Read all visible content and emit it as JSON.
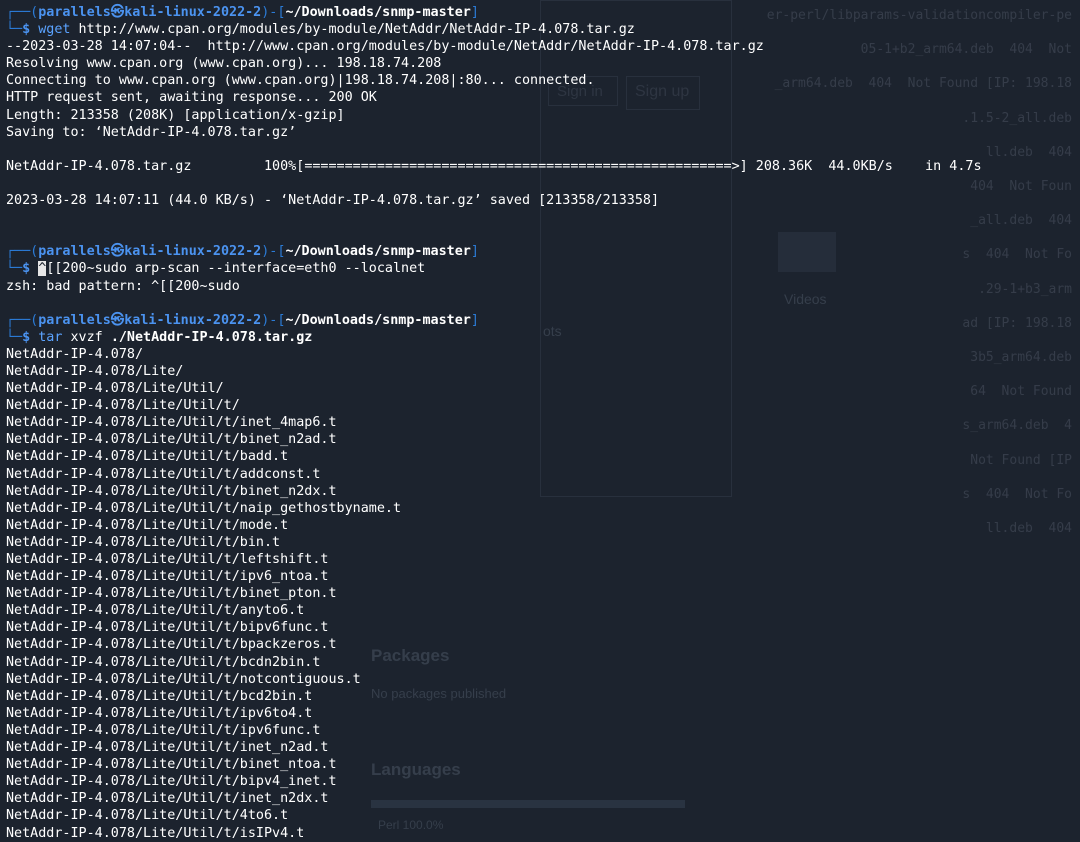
{
  "background_window": {
    "right_column": [
      "er-perl/libparams-validationcompiler-pe",
      "05-1+b2_arm64.deb  404  Not",
      "_arm64.deb  404  Not Found [IP: 198.18",
      ".1.5-2_all.deb",
      "ll.deb  404",
      "404  Not Foun",
      "_all.deb  404",
      "s  404  Not Fo",
      ".29-1+b3_arm",
      "ad [IP: 198.18",
      "3b5_arm64.deb",
      "64  Not Found",
      "s_arm64.deb  4",
      "Not Found [IP",
      "s  404  Not Fo",
      "ll.deb  404"
    ],
    "sign_in": "Sign in",
    "sign_up": "Sign up",
    "videos": "Videos",
    "packages_heading": "Packages",
    "packages_sub": "No packages published",
    "languages_heading": "Languages",
    "language_item": "Perl 100.0%",
    "ots": "ots"
  },
  "terminal": {
    "prompt": {
      "user_host": "parallels㉿kali-linux-2022-2",
      "path": "~/Downloads/snmp-master"
    },
    "block1": {
      "cmd": "wget",
      "args": " http://www.cpan.org/modules/by-module/NetAddr/NetAddr-IP-4.078.tar.gz",
      "output": [
        "--2023-03-28 14:07:04--  http://www.cpan.org/modules/by-module/NetAddr/NetAddr-IP-4.078.tar.gz",
        "Resolving www.cpan.org (www.cpan.org)... 198.18.74.208",
        "Connecting to www.cpan.org (www.cpan.org)|198.18.74.208|:80... connected.",
        "HTTP request sent, awaiting response... 200 OK",
        "Length: 213358 (208K) [application/x-gzip]",
        "Saving to: ‘NetAddr-IP-4.078.tar.gz’",
        ""
      ],
      "progress_file": "NetAddr-IP-4.078.tar.gz",
      "progress_pct": "100%",
      "progress_fraction": 1.0,
      "progress_stats": " 208.36K  44.0KB/s    in 4.7s",
      "saved_line": "2023-03-28 14:07:11 (44.0 KB/s) - ‘NetAddr-IP-4.078.tar.gz’ saved [213358/213358]"
    },
    "block2": {
      "cursor_char": "^",
      "cmd_rest": "[[200~sudo arp-scan --interface=eth0 --localnet",
      "output": "zsh: bad pattern: ^[[200~sudo"
    },
    "block3": {
      "cmd": "tar",
      "args": " xvzf ",
      "arg_bold": "./NetAddr-IP-4.078.tar.gz",
      "output": [
        "NetAddr-IP-4.078/",
        "NetAddr-IP-4.078/Lite/",
        "NetAddr-IP-4.078/Lite/Util/",
        "NetAddr-IP-4.078/Lite/Util/t/",
        "NetAddr-IP-4.078/Lite/Util/t/inet_4map6.t",
        "NetAddr-IP-4.078/Lite/Util/t/binet_n2ad.t",
        "NetAddr-IP-4.078/Lite/Util/t/badd.t",
        "NetAddr-IP-4.078/Lite/Util/t/addconst.t",
        "NetAddr-IP-4.078/Lite/Util/t/binet_n2dx.t",
        "NetAddr-IP-4.078/Lite/Util/t/naip_gethostbyname.t",
        "NetAddr-IP-4.078/Lite/Util/t/mode.t",
        "NetAddr-IP-4.078/Lite/Util/t/bin.t",
        "NetAddr-IP-4.078/Lite/Util/t/leftshift.t",
        "NetAddr-IP-4.078/Lite/Util/t/ipv6_ntoa.t",
        "NetAddr-IP-4.078/Lite/Util/t/binet_pton.t",
        "NetAddr-IP-4.078/Lite/Util/t/anyto6.t",
        "NetAddr-IP-4.078/Lite/Util/t/bipv6func.t",
        "NetAddr-IP-4.078/Lite/Util/t/bpackzeros.t",
        "NetAddr-IP-4.078/Lite/Util/t/bcdn2bin.t",
        "NetAddr-IP-4.078/Lite/Util/t/notcontiguous.t",
        "NetAddr-IP-4.078/Lite/Util/t/bcd2bin.t",
        "NetAddr-IP-4.078/Lite/Util/t/ipv6to4.t",
        "NetAddr-IP-4.078/Lite/Util/t/ipv6func.t",
        "NetAddr-IP-4.078/Lite/Util/t/inet_n2ad.t",
        "NetAddr-IP-4.078/Lite/Util/t/binet_ntoa.t",
        "NetAddr-IP-4.078/Lite/Util/t/bipv4_inet.t",
        "NetAddr-IP-4.078/Lite/Util/t/inet_n2dx.t",
        "NetAddr-IP-4.078/Lite/Util/t/4to6.t",
        "NetAddr-IP-4.078/Lite/Util/t/isIPv4.t"
      ]
    }
  }
}
